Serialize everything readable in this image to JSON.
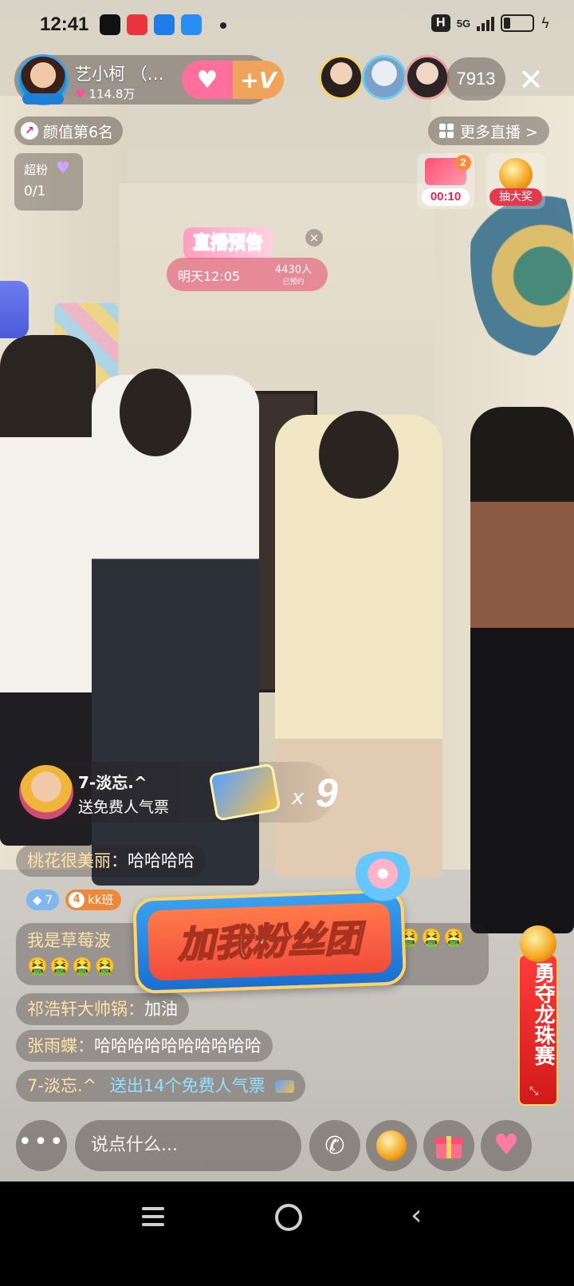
{
  "status_bar": {
    "time": "12:41",
    "network": "5G",
    "icons": [
      "tiktok-icon",
      "video-icon",
      "browser-icon",
      "app-icon",
      "dot-icon",
      "h-icon",
      "signal-icon",
      "battery-icon",
      "charging-icon"
    ]
  },
  "host": {
    "name": "艺小柯 （…",
    "likes": "114.8万",
    "follow_icons": [
      "heart-plus-icon",
      "plus-v-icon"
    ]
  },
  "viewers": {
    "count": "7913"
  },
  "rank": {
    "label": "颜值第6名"
  },
  "more_live": {
    "label": "更多直播 >"
  },
  "superfan": {
    "label": "超粉",
    "value": "0/1"
  },
  "gift_timer": {
    "badge": "2",
    "time": "00:10"
  },
  "lottery": {
    "label": "抽大奖"
  },
  "preview": {
    "title": "直播预告",
    "time": "明天12:05",
    "count": "4430人",
    "count_sub": "已预约",
    "close": "×"
  },
  "gift_message": {
    "user": "7-淡忘.^",
    "text": "送免费人气票",
    "multiplier": "x",
    "count": "9"
  },
  "chat": {
    "row1": {
      "user": "桃花很美丽：",
      "text": "哈哈哈哈"
    },
    "badges": {
      "level": "7",
      "club_num": "4",
      "club": "kk班"
    },
    "row2": {
      "user": "我是草莓波",
      "emoji_right": "🤮🤮🤮",
      "emoji_line2": "🤮🤮🤮🤮"
    },
    "row3": {
      "user": "祁浩轩大帅锅：",
      "text": "加油"
    },
    "row4": {
      "user": "张雨蝶：",
      "text": "哈哈哈哈哈哈哈哈哈哈"
    },
    "row5": {
      "user": "7-淡忘.^",
      "text": "送出14个免费人气票"
    }
  },
  "fan_club": {
    "label": "加我粉丝团"
  },
  "race": {
    "label": "勇夺龙珠赛",
    "expand": "⤡"
  },
  "toolbar": {
    "more": "•••",
    "input_placeholder": "说点什么..."
  },
  "colors": {
    "accent_pink": "#ff6f9e",
    "accent_red": "#e23a4e",
    "chat_user": "#ffe2a6",
    "system_text": "#8fe1ff"
  }
}
